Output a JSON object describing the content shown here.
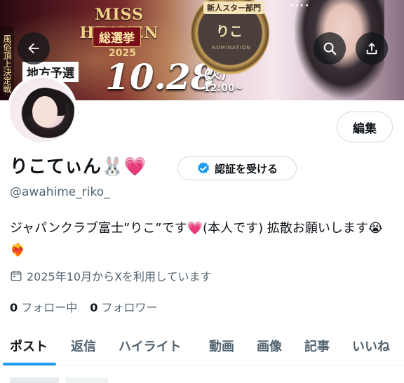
{
  "banner": {
    "event_title": "MISS HEAVEN",
    "event_subtitle": "総選挙",
    "event_year": "2025",
    "label": "地方予選",
    "date": "10.28",
    "weekday": "(火)",
    "time": "12:00~",
    "vertical_text": "風俗頂上決定戦",
    "medal_category": "新人スター部門",
    "medal_name": "りこ",
    "medal_tag": "NOMINATION",
    "signal_text": "....",
    "back_label": "back",
    "search_label": "search",
    "share_label": "share"
  },
  "profile": {
    "edit_label": "編集",
    "display_name": "りこてぃん🐰💗",
    "verify_label": "認証を受ける",
    "handle": "@awahime_riko_",
    "bio": "ジャパンクラブ富士”りこ”です💗(本人です) 拡散お願いします😭❤️‍🔥",
    "joined": "2025年10月からXを利用しています",
    "following_count": "0",
    "following_label": "フォロー中",
    "followers_count": "0",
    "followers_label": "フォロワー"
  },
  "tabs": [
    {
      "label": "ポスト",
      "active": true
    },
    {
      "label": "返信"
    },
    {
      "label": "ハイライト"
    },
    {
      "label": "動画"
    },
    {
      "label": "画像"
    },
    {
      "label": "記事"
    },
    {
      "label": "いいね"
    }
  ],
  "colors": {
    "accent": "#1d9bf0",
    "text_primary": "#0f1419",
    "text_secondary": "#536471",
    "border": "#cfd9de",
    "verify_badge": "#1d9bf0"
  },
  "icons": {
    "back": "arrow-left-icon",
    "search": "search-icon",
    "share": "share-icon",
    "verify": "verified-badge-icon",
    "calendar": "calendar-icon"
  }
}
